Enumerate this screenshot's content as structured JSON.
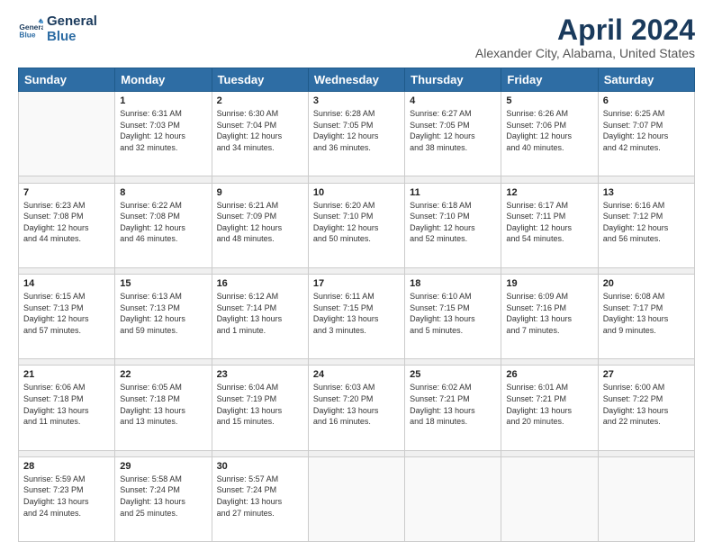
{
  "logo": {
    "line1": "General",
    "line2": "Blue"
  },
  "title": "April 2024",
  "subtitle": "Alexander City, Alabama, United States",
  "days_header": [
    "Sunday",
    "Monday",
    "Tuesday",
    "Wednesday",
    "Thursday",
    "Friday",
    "Saturday"
  ],
  "weeks": [
    [
      {
        "num": "",
        "info": ""
      },
      {
        "num": "1",
        "info": "Sunrise: 6:31 AM\nSunset: 7:03 PM\nDaylight: 12 hours\nand 32 minutes."
      },
      {
        "num": "2",
        "info": "Sunrise: 6:30 AM\nSunset: 7:04 PM\nDaylight: 12 hours\nand 34 minutes."
      },
      {
        "num": "3",
        "info": "Sunrise: 6:28 AM\nSunset: 7:05 PM\nDaylight: 12 hours\nand 36 minutes."
      },
      {
        "num": "4",
        "info": "Sunrise: 6:27 AM\nSunset: 7:05 PM\nDaylight: 12 hours\nand 38 minutes."
      },
      {
        "num": "5",
        "info": "Sunrise: 6:26 AM\nSunset: 7:06 PM\nDaylight: 12 hours\nand 40 minutes."
      },
      {
        "num": "6",
        "info": "Sunrise: 6:25 AM\nSunset: 7:07 PM\nDaylight: 12 hours\nand 42 minutes."
      }
    ],
    [
      {
        "num": "7",
        "info": "Sunrise: 6:23 AM\nSunset: 7:08 PM\nDaylight: 12 hours\nand 44 minutes."
      },
      {
        "num": "8",
        "info": "Sunrise: 6:22 AM\nSunset: 7:08 PM\nDaylight: 12 hours\nand 46 minutes."
      },
      {
        "num": "9",
        "info": "Sunrise: 6:21 AM\nSunset: 7:09 PM\nDaylight: 12 hours\nand 48 minutes."
      },
      {
        "num": "10",
        "info": "Sunrise: 6:20 AM\nSunset: 7:10 PM\nDaylight: 12 hours\nand 50 minutes."
      },
      {
        "num": "11",
        "info": "Sunrise: 6:18 AM\nSunset: 7:10 PM\nDaylight: 12 hours\nand 52 minutes."
      },
      {
        "num": "12",
        "info": "Sunrise: 6:17 AM\nSunset: 7:11 PM\nDaylight: 12 hours\nand 54 minutes."
      },
      {
        "num": "13",
        "info": "Sunrise: 6:16 AM\nSunset: 7:12 PM\nDaylight: 12 hours\nand 56 minutes."
      }
    ],
    [
      {
        "num": "14",
        "info": "Sunrise: 6:15 AM\nSunset: 7:13 PM\nDaylight: 12 hours\nand 57 minutes."
      },
      {
        "num": "15",
        "info": "Sunrise: 6:13 AM\nSunset: 7:13 PM\nDaylight: 12 hours\nand 59 minutes."
      },
      {
        "num": "16",
        "info": "Sunrise: 6:12 AM\nSunset: 7:14 PM\nDaylight: 13 hours\nand 1 minute."
      },
      {
        "num": "17",
        "info": "Sunrise: 6:11 AM\nSunset: 7:15 PM\nDaylight: 13 hours\nand 3 minutes."
      },
      {
        "num": "18",
        "info": "Sunrise: 6:10 AM\nSunset: 7:15 PM\nDaylight: 13 hours\nand 5 minutes."
      },
      {
        "num": "19",
        "info": "Sunrise: 6:09 AM\nSunset: 7:16 PM\nDaylight: 13 hours\nand 7 minutes."
      },
      {
        "num": "20",
        "info": "Sunrise: 6:08 AM\nSunset: 7:17 PM\nDaylight: 13 hours\nand 9 minutes."
      }
    ],
    [
      {
        "num": "21",
        "info": "Sunrise: 6:06 AM\nSunset: 7:18 PM\nDaylight: 13 hours\nand 11 minutes."
      },
      {
        "num": "22",
        "info": "Sunrise: 6:05 AM\nSunset: 7:18 PM\nDaylight: 13 hours\nand 13 minutes."
      },
      {
        "num": "23",
        "info": "Sunrise: 6:04 AM\nSunset: 7:19 PM\nDaylight: 13 hours\nand 15 minutes."
      },
      {
        "num": "24",
        "info": "Sunrise: 6:03 AM\nSunset: 7:20 PM\nDaylight: 13 hours\nand 16 minutes."
      },
      {
        "num": "25",
        "info": "Sunrise: 6:02 AM\nSunset: 7:21 PM\nDaylight: 13 hours\nand 18 minutes."
      },
      {
        "num": "26",
        "info": "Sunrise: 6:01 AM\nSunset: 7:21 PM\nDaylight: 13 hours\nand 20 minutes."
      },
      {
        "num": "27",
        "info": "Sunrise: 6:00 AM\nSunset: 7:22 PM\nDaylight: 13 hours\nand 22 minutes."
      }
    ],
    [
      {
        "num": "28",
        "info": "Sunrise: 5:59 AM\nSunset: 7:23 PM\nDaylight: 13 hours\nand 24 minutes."
      },
      {
        "num": "29",
        "info": "Sunrise: 5:58 AM\nSunset: 7:24 PM\nDaylight: 13 hours\nand 25 minutes."
      },
      {
        "num": "30",
        "info": "Sunrise: 5:57 AM\nSunset: 7:24 PM\nDaylight: 13 hours\nand 27 minutes."
      },
      {
        "num": "",
        "info": ""
      },
      {
        "num": "",
        "info": ""
      },
      {
        "num": "",
        "info": ""
      },
      {
        "num": "",
        "info": ""
      }
    ]
  ]
}
